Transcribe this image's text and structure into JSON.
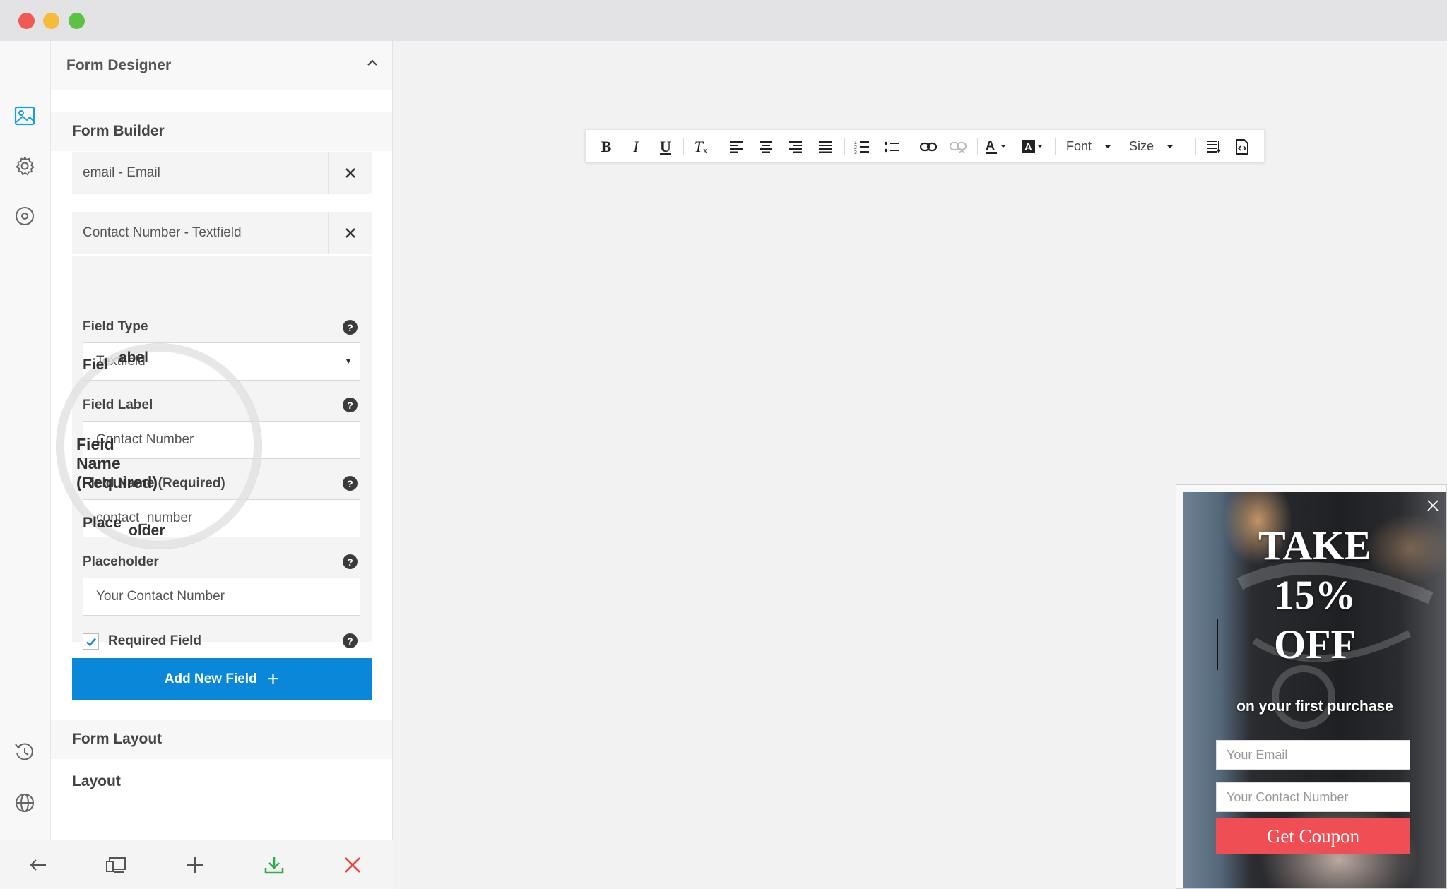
{
  "window": {
    "traffic_lights": [
      "close",
      "minimize",
      "maximize"
    ]
  },
  "rail": {
    "icons": [
      "image-icon",
      "gear-icon",
      "target-icon",
      "history-icon",
      "globe-icon"
    ]
  },
  "panel": {
    "title": "Form Designer",
    "form_builder": "Form Builder",
    "fields": [
      {
        "label": "email - Email"
      },
      {
        "label": "Contact Number - Textfield"
      }
    ],
    "editor": {
      "field_type_label": "Field Type",
      "field_type_value": "Textfield",
      "field_label_label": "Field Label",
      "field_label_value": "Contact Number",
      "field_name_label": "Field Name (Required)",
      "field_name_value": "contact_number",
      "placeholder_label": "Placeholder",
      "placeholder_value": "Your Contact Number",
      "required_label": "Required Field",
      "required_checked": true,
      "help_glyph": "?"
    },
    "add_button": "Add New Field",
    "form_layout": "Form Layout",
    "layout": "Layout"
  },
  "magnifier": {
    "label_fragment_1": "Fiel",
    "label_fragment_2": "abel",
    "field_label_value": "Contact Number",
    "field_name_label": "Field Name (Required)",
    "field_name_value": "contact_number",
    "placeholder_fragment_1": "Place",
    "placeholder_fragment_2": "older"
  },
  "toolbar": {
    "bold": "B",
    "italic": "I",
    "underline": "U",
    "clear_format": "T",
    "font_label": "Font",
    "size_label": "Size"
  },
  "popup": {
    "line1": "TAKE",
    "line2": "15%",
    "line3": "OFF",
    "subtitle": "on your first purchase",
    "email_placeholder": "Your Email",
    "contact_placeholder": "Your Contact Number",
    "button": "Get Coupon",
    "colors": {
      "button": "#f04e55"
    }
  },
  "bottom_bar": {
    "icons": [
      "back-arrow-icon",
      "devices-icon",
      "plus-icon",
      "download-icon",
      "close-icon"
    ]
  },
  "colors": {
    "accent": "#0b87d9",
    "download": "#2fae4f",
    "close": "#e64339"
  }
}
